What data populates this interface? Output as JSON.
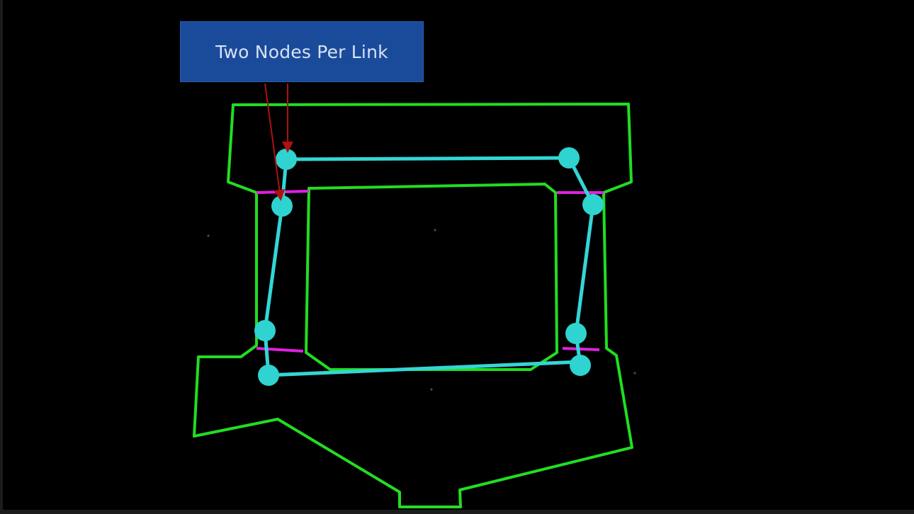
{
  "callout": {
    "label": "Two Nodes Per Link"
  },
  "colors": {
    "background": "#000000",
    "outline": "#22dd22",
    "link": "#33d6d6",
    "node": "#2fd3cf",
    "pin_marker": "#e020e0",
    "callout_bg": "#1a4a9a",
    "callout_text": "#d6e2f2",
    "arrow": "#b01010"
  }
}
